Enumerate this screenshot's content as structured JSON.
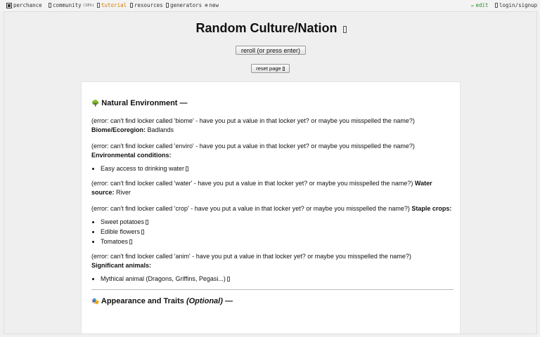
{
  "topbar": {
    "site": "perchance",
    "community": "community",
    "community_count": "(1Eh)",
    "tutorial": "tutorial",
    "resources": "resources",
    "generators": "generators",
    "new": "new",
    "edit": "edit",
    "login": "login/signup"
  },
  "page": {
    "title": "Random Culture/Nation",
    "reroll_label": "reroll (or press enter)",
    "reset_label": "reset page"
  },
  "sections": {
    "natural": {
      "emoji": "🌳",
      "heading": "Natural Environment —",
      "biome_error": "(error: can't find locker called 'biome' - have you put a value in that locker yet? or maybe you misspelled the name?)",
      "biome_label": "Biome/Ecoregion:",
      "biome_value": "Badlands",
      "enviro_error": "(error: can't find locker called 'enviro' - have you put a value in that locker yet? or maybe you misspelled the name?)",
      "enviro_label": "Environmental conditions:",
      "enviro_items": [
        "Easy access to drinking water"
      ],
      "water_error": "(error: can't find locker called 'water' - have you put a value in that locker yet? or maybe you misspelled the name?)",
      "water_label": "Water source:",
      "water_value": "River",
      "crop_error": "(error: can't find locker called 'crop' - have you put a value in that locker yet? or maybe you misspelled the name?)",
      "crop_label": "Staple crops:",
      "crop_items": [
        "Sweet potatoes",
        "Edible flowers",
        "Tomatoes"
      ],
      "anim_error": "(error: can't find locker called 'anim' - have you put a value in that locker yet? or maybe you misspelled the name?)",
      "anim_label": "Significant animals:",
      "anim_items": [
        "Mythical animal (Dragons, Griffins, Pegasi...)"
      ]
    },
    "appearance": {
      "emoji": "🎭",
      "heading": "Appearance and Traits",
      "heading_optional": "(Optional)",
      "heading_dash": "—"
    }
  }
}
